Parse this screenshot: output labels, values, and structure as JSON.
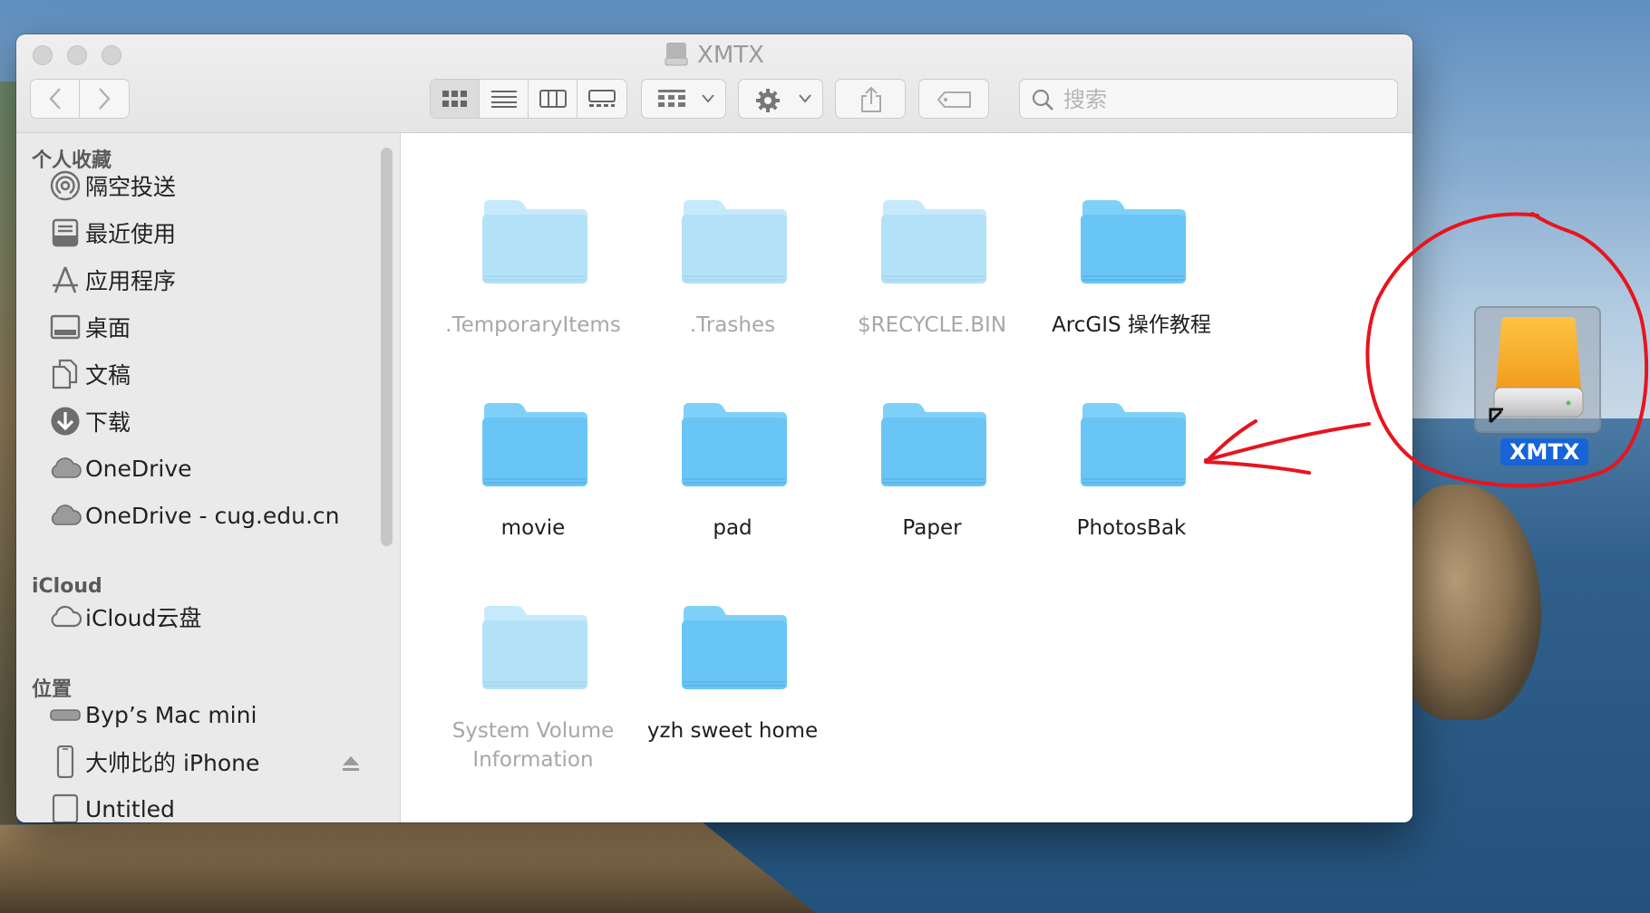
{
  "window": {
    "title": "XMTX"
  },
  "toolbar": {
    "back_icon": "chevron-left-icon",
    "forward_icon": "chevron-right-icon",
    "view_modes": [
      "icon-view",
      "list-view",
      "column-view",
      "gallery-view"
    ],
    "active_view": "icon-view",
    "group_icon": "group-grid-icon",
    "action_icon": "gear-icon",
    "share_icon": "share-icon",
    "tag_icon": "tag-icon",
    "search_placeholder": "搜索"
  },
  "sidebar": {
    "favorites_heading": "个人收藏",
    "favorites": [
      {
        "label": "隔空投送",
        "icon": "airdrop-icon"
      },
      {
        "label": "最近使用",
        "icon": "recents-icon"
      },
      {
        "label": "应用程序",
        "icon": "applications-icon"
      },
      {
        "label": "桌面",
        "icon": "desktop-icon"
      },
      {
        "label": "文稿",
        "icon": "documents-icon"
      },
      {
        "label": "下载",
        "icon": "downloads-icon"
      },
      {
        "label": "OneDrive",
        "icon": "cloud-icon"
      },
      {
        "label": "OneDrive - cug.edu.cn",
        "icon": "cloud-icon"
      }
    ],
    "icloud_heading": "iCloud",
    "icloud": [
      {
        "label": "iCloud云盘",
        "icon": "icloud-icon"
      }
    ],
    "locations_heading": "位置",
    "locations": [
      {
        "label": "Byp’s Mac mini",
        "icon": "mac-mini-icon"
      },
      {
        "label": "大帅比的 iPhone",
        "icon": "iphone-icon"
      },
      {
        "label": "Untitled",
        "icon": "disk-icon"
      }
    ]
  },
  "folders": [
    {
      "name": ".TemporaryItems",
      "hidden": true
    },
    {
      "name": ".Trashes",
      "hidden": true
    },
    {
      "name": "$RECYCLE.BIN",
      "hidden": true
    },
    {
      "name": "ArcGIS 操作教程",
      "hidden": false
    },
    {
      "name": "movie",
      "hidden": false
    },
    {
      "name": "pad",
      "hidden": false
    },
    {
      "name": "Paper",
      "hidden": false
    },
    {
      "name": "PhotosBak",
      "hidden": false
    },
    {
      "name": "System Volume Information",
      "hidden": true
    },
    {
      "name": "yzh sweet home",
      "hidden": false
    }
  ],
  "desktop": {
    "drive_label": "XMTX",
    "drive_icon": "external-drive-icon"
  },
  "colors": {
    "folder_blue": "#69c5f5",
    "folder_light": "#b7e2f8",
    "annotation_red": "#e8141e",
    "selection_blue": "#1664d8"
  }
}
